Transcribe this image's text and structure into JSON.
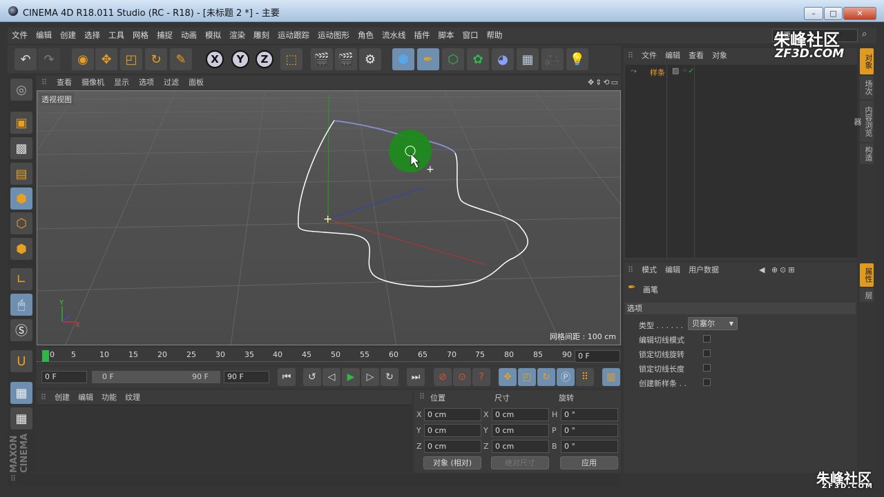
{
  "window": {
    "title": "CINEMA 4D R18.011 Studio (RC - R18) - [未标题 2 *] - 主要",
    "layout_field": "主要"
  },
  "menu": [
    "文件",
    "编辑",
    "创建",
    "选择",
    "工具",
    "网格",
    "捕捉",
    "动画",
    "模拟",
    "渲染",
    "雕刻",
    "运动跟踪",
    "运动图形",
    "角色",
    "流水线",
    "插件",
    "脚本",
    "窗口",
    "帮助"
  ],
  "toolbar": {
    "axis_x": "X",
    "axis_y": "Y",
    "axis_z": "Z"
  },
  "viewport": {
    "menu": [
      "查看",
      "摄像机",
      "显示",
      "选项",
      "过滤",
      "面板"
    ],
    "label": "透视视图",
    "grid_info": "网格间距 : 100 cm",
    "axis_labels": {
      "x": "X",
      "y": "Y"
    }
  },
  "timeline": {
    "ticks": [
      "0",
      "5",
      "10",
      "15",
      "20",
      "25",
      "30",
      "35",
      "40",
      "45",
      "50",
      "55",
      "60",
      "65",
      "70",
      "75",
      "80",
      "85",
      "90"
    ],
    "current_frame": "0 F"
  },
  "transport": {
    "start": "0 F",
    "range_start": "0 F",
    "range_end": "90 F",
    "end": "90 F"
  },
  "materials": {
    "menu": [
      "创建",
      "编辑",
      "功能",
      "纹理"
    ]
  },
  "coordinates": {
    "headers": [
      "位置",
      "尺寸",
      "旋转"
    ],
    "rows": [
      {
        "l1": "X",
        "p": "0 cm",
        "l2": "X",
        "s": "0 cm",
        "l3": "H",
        "r": "0 °"
      },
      {
        "l1": "Y",
        "p": "0 cm",
        "l2": "Y",
        "s": "0 cm",
        "l3": "P",
        "r": "0 °"
      },
      {
        "l1": "Z",
        "p": "0 cm",
        "l2": "Z",
        "s": "0 cm",
        "l3": "B",
        "r": "0 °"
      }
    ],
    "mode": "对象 (相对)",
    "size_mode": "绝对尺寸",
    "apply": "应用"
  },
  "objects": {
    "menu": [
      "文件",
      "编辑",
      "查看",
      "对象"
    ],
    "items": [
      {
        "name": "样条"
      }
    ]
  },
  "attributes": {
    "menu": [
      "模式",
      "编辑",
      "用户数据"
    ],
    "tool_name": "画笔",
    "section": "选项",
    "type_label": "类型 . . . . . .",
    "type_value": "贝塞尔",
    "options": [
      "编辑切线模式",
      "锁定切线旋转",
      "锁定切线长度",
      "创建新样条 . ."
    ]
  },
  "right_tabs": [
    "对象",
    "场次",
    "内容浏览器",
    "构造",
    "属性",
    "层"
  ],
  "watermarks": {
    "top": "朱峰社区",
    "top_sub": "ZF3D.COM",
    "bottom": "朱峰社区",
    "bottom_sub": "ZF3D.COM"
  },
  "brand": "MAXON CINEMA"
}
